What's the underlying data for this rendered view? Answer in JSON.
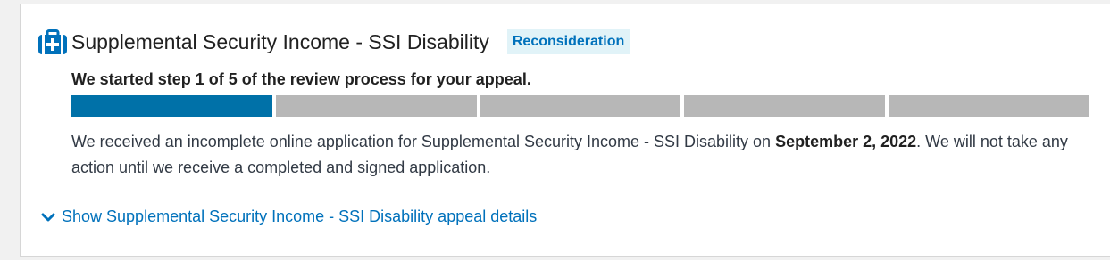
{
  "card": {
    "icon": "medical-briefcase-icon",
    "title": "Supplemental Security Income - SSI Disability",
    "badge": "Reconsideration",
    "step_text": "We started step 1 of 5 of the review process for your appeal.",
    "progress": {
      "current_step": 1,
      "total_steps": 5
    },
    "description": {
      "before": "We received an incomplete online application for Supplemental Security Income - SSI Disability on ",
      "date": "September 2, 2022",
      "after": ". We will not take any action until we receive a completed and signed application."
    },
    "details_link": {
      "icon": "chevron-down-icon",
      "label": "Show Supplemental Security Income - SSI Disability appeal details"
    }
  },
  "colors": {
    "accent": "#0071bb",
    "progress_complete": "#0071a8",
    "progress_incomplete": "#b7b7b7",
    "badge_bg": "#e1f3f8"
  }
}
